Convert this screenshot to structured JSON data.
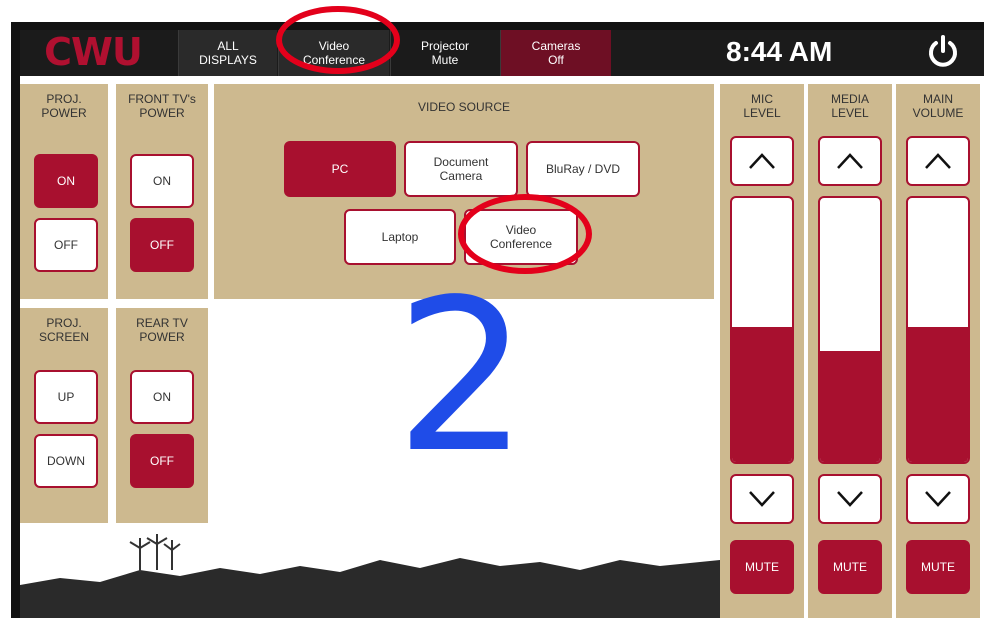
{
  "topbar": {
    "logo": "CWU",
    "buttons": [
      {
        "label": "ALL\nDISPLAYS"
      },
      {
        "label": "Video\nConference"
      },
      {
        "label": "Projector\nMute"
      },
      {
        "label": "Cameras\nOff"
      }
    ],
    "time": "8:44 AM",
    "power_icon": "power-icon"
  },
  "proj_power": {
    "label": "PROJ.\nPOWER",
    "on": "ON",
    "off": "OFF",
    "active": "on"
  },
  "front_tv_power": {
    "label": "FRONT TV's\nPOWER",
    "on": "ON",
    "off": "OFF",
    "active": "off"
  },
  "proj_screen": {
    "label": "PROJ.\nSCREEN",
    "up": "UP",
    "down": "DOWN"
  },
  "rear_tv_power": {
    "label": "REAR TV\nPOWER",
    "on": "ON",
    "off": "OFF",
    "active": "off"
  },
  "video_source": {
    "label": "VIDEO SOURCE",
    "sources": [
      {
        "label": "PC",
        "selected": true
      },
      {
        "label": "Document\nCamera",
        "selected": false
      },
      {
        "label": "BluRay / DVD",
        "selected": false
      },
      {
        "label": "Laptop",
        "selected": false
      },
      {
        "label": "Video\nConference",
        "selected": false
      }
    ]
  },
  "levels": [
    {
      "label": "MIC\nLEVEL",
      "mute": "MUTE",
      "level": 0.51
    },
    {
      "label": "MEDIA\nLEVEL",
      "mute": "MUTE",
      "level": 0.42
    },
    {
      "label": "MAIN\nVOLUME",
      "mute": "MUTE",
      "level": 0.51
    }
  ],
  "annotation": {
    "step": "2"
  },
  "colors": {
    "accent": "#a8102f",
    "panel": "#cdb98f",
    "annotation_ring": "#e3001b",
    "annotation_number": "#1f4ce8"
  }
}
